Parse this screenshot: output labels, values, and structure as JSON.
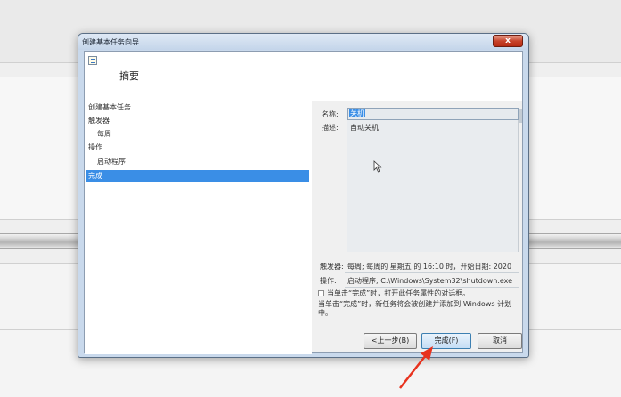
{
  "window": {
    "title": "创建基本任务向导",
    "close_glyph": "x"
  },
  "header": {
    "title": "摘要"
  },
  "steps": [
    {
      "label": "创建基本任务"
    },
    {
      "label": "触发器"
    },
    {
      "label": "每周"
    },
    {
      "label": "操作"
    },
    {
      "label": "启动程序"
    },
    {
      "label": "完成"
    }
  ],
  "summary": {
    "name_label": "名称:",
    "name_value": "关机",
    "desc_label": "描述:",
    "desc_value": "自动关机",
    "trigger_label": "触发器:",
    "trigger_value": "每周; 每周的 星期五 的 16:10 时，开始日期: 2020",
    "action_label": "操作:",
    "action_value": "启动程序; C:\\Windows\\System32\\shutdown.exe",
    "checkbox_label": "当单击“完成”时，打开此任务属性的对话框。",
    "note": "当单击“完成”时，新任务将会被创建并添加到 Windows 计划中。"
  },
  "buttons": {
    "back": "<上一步(B)",
    "finish": "完成(F)",
    "cancel": "取消"
  },
  "colors": {
    "selection": "#3a8ee6",
    "arrow": "#e8321e"
  }
}
